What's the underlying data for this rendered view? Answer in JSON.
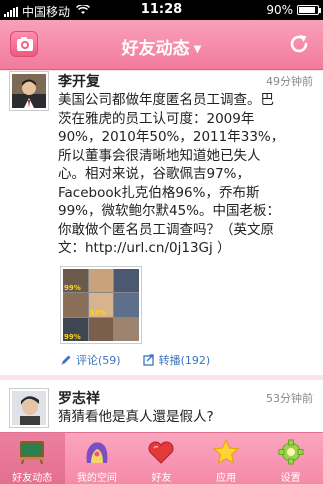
{
  "status_bar": {
    "carrier": "中国移动",
    "time": "11:28",
    "battery": "90%",
    "battery_level": 0.9
  },
  "navbar": {
    "title": "好友动态"
  },
  "posts": [
    {
      "author": "李开复",
      "time": "49分钟前",
      "lines": [
        "美国公司都做年度匿名员工调查。巴",
        "茨在雅虎的员工认可度：2009年",
        "90%，2010年50%，2011年33%，",
        "所以董事会很清晰地知道她已失人",
        "心。相对来说，谷歌佩吉97%，",
        "Facebook扎克伯格96%，乔布斯",
        "99%，微软鲍尔默45%。中国老板：",
        "你敢做个匿名员工调查吗？（英文原",
        "文：http://url.cn/0j13Gj ）"
      ],
      "thumb_labels": [
        "99%",
        "33%",
        "99%"
      ],
      "comment_label": "评论",
      "comment_count": "(59)",
      "repost_label": "转播",
      "repost_count": "(192)"
    },
    {
      "author": "罗志祥",
      "time": "53分钟前",
      "lines": [
        "猜猜看他是真人還是假人?"
      ]
    }
  ],
  "tabs": [
    {
      "label": "好友动态",
      "icon": "easel-icon"
    },
    {
      "label": "我的空间",
      "icon": "space-icon"
    },
    {
      "label": "好友",
      "icon": "heart-icon"
    },
    {
      "label": "应用",
      "icon": "star-icon"
    },
    {
      "label": "设置",
      "icon": "gear-icon"
    }
  ],
  "colors": {
    "accent": "#f27b9c",
    "link": "#3a74c2",
    "background": "#fbe3ea"
  }
}
